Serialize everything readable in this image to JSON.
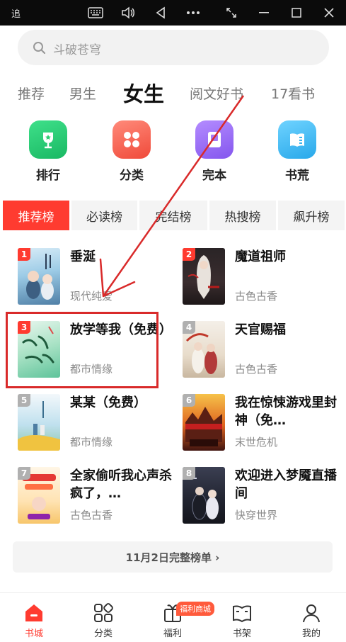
{
  "window": {
    "app_name": "追",
    "icons": [
      "keyboard-icon",
      "volume-icon",
      "back-icon",
      "more-icon",
      "resize-icon",
      "minimize-icon",
      "maximize-icon",
      "close-icon"
    ]
  },
  "search": {
    "placeholder": "斗破苍穹"
  },
  "channels": [
    "推荐",
    "男生",
    "女生",
    "阅文好书",
    "17看书"
  ],
  "active_channel": "女生",
  "entries": [
    {
      "label": "排行",
      "icon": "trophy-icon",
      "color": "#2ecc71"
    },
    {
      "label": "分类",
      "icon": "category-grid-icon",
      "color": "#ff6b5b"
    },
    {
      "label": "完本",
      "icon": "book-complete-icon",
      "color": "#9b6cf2"
    },
    {
      "label": "书荒",
      "icon": "open-book-icon",
      "color": "#3bb6f0"
    }
  ],
  "rank_tabs": [
    "推荐榜",
    "必读榜",
    "完结榜",
    "热搜榜",
    "飙升榜"
  ],
  "books": [
    {
      "rank": "1",
      "title": "垂涎",
      "genre": "现代纯爱"
    },
    {
      "rank": "2",
      "title": "魔道祖师",
      "genre": "古色古香"
    },
    {
      "rank": "3",
      "title": "放学等我（免费）",
      "genre": "都市情缘"
    },
    {
      "rank": "4",
      "title": "天官赐福",
      "genre": "古色古香"
    },
    {
      "rank": "5",
      "title": "某某（免费）",
      "genre": "都市情缘"
    },
    {
      "rank": "6",
      "title": "我在惊悚游戏里封神（免…",
      "genre": "末世危机"
    },
    {
      "rank": "7",
      "title": "全家偷听我心声杀疯了，…",
      "genre": "古色古香"
    },
    {
      "rank": "8",
      "title": "欢迎进入梦魇直播间",
      "genre": "快穿世界"
    }
  ],
  "full_list_label": "11月2日完整榜单 ›",
  "bottom_nav": [
    {
      "label": "书城",
      "icon": "home-icon"
    },
    {
      "label": "分类",
      "icon": "category-icon"
    },
    {
      "label": "福利",
      "icon": "gift-icon"
    },
    {
      "label": "书架",
      "icon": "bookshelf-icon"
    },
    {
      "label": "我的",
      "icon": "profile-icon"
    }
  ],
  "welfare_badge": "福利商城",
  "colors": {
    "accent": "#ff3b30",
    "rank_top": "#ff3b30",
    "rank_other": "#b0b0b0",
    "annotation": "#d92a2a"
  }
}
